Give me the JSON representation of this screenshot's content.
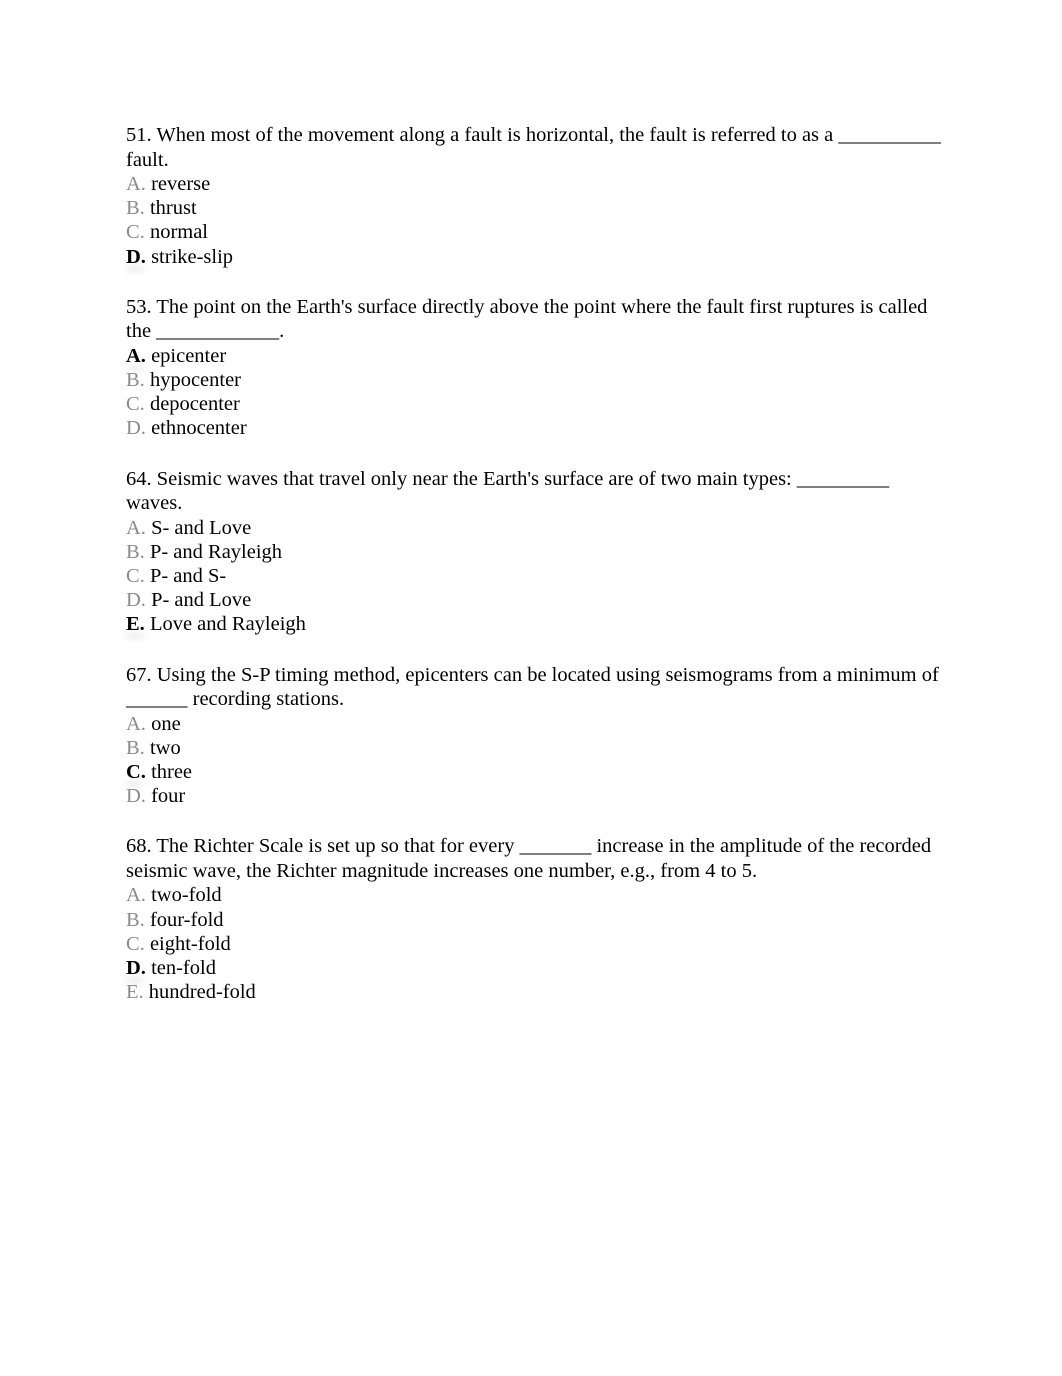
{
  "questions": [
    {
      "number": "51.",
      "text": "When most of the movement along a fault is horizontal, the fault is referred to as a __________ fault.",
      "options": [
        {
          "letter": "A.",
          "text": "reverse",
          "correct": false
        },
        {
          "letter": "B.",
          "text": "thrust",
          "correct": false
        },
        {
          "letter": "C.",
          "text": "normal",
          "correct": false
        },
        {
          "letter": "D.",
          "text": "strike-slip",
          "correct": true
        }
      ]
    },
    {
      "number": "53.",
      "text": "The point on the Earth's surface directly above the point where the fault first ruptures is called the ____________.",
      "options": [
        {
          "letter": "A.",
          "text": "epicenter",
          "correct": true
        },
        {
          "letter": "B.",
          "text": "hypocenter",
          "correct": false
        },
        {
          "letter": "C.",
          "text": "depocenter",
          "correct": false
        },
        {
          "letter": "D.",
          "text": "ethnocenter",
          "correct": false
        }
      ]
    },
    {
      "number": "64.",
      "text": "Seismic waves that travel only near the Earth's surface are of two main types: _________ waves.",
      "options": [
        {
          "letter": "A.",
          "text": "S- and Love",
          "correct": false
        },
        {
          "letter": "B.",
          "text": "P- and Rayleigh",
          "correct": false
        },
        {
          "letter": "C.",
          "text": "P- and S-",
          "correct": false
        },
        {
          "letter": "D.",
          "text": "P- and Love",
          "correct": false
        },
        {
          "letter": "E.",
          "text": "Love and Rayleigh",
          "correct": true
        }
      ]
    },
    {
      "number": "67.",
      "text": "Using the S-P timing method, epicenters can be located using seismograms from a minimum of ______ recording stations.",
      "options": [
        {
          "letter": "A.",
          "text": "one",
          "correct": false
        },
        {
          "letter": "B.",
          "text": "two",
          "correct": false
        },
        {
          "letter": "C.",
          "text": "three",
          "correct": true
        },
        {
          "letter": "D.",
          "text": "four",
          "correct": false
        }
      ]
    },
    {
      "number": "68.",
      "text": "The Richter Scale is set up so that for every _______ increase in the amplitude of the recorded seismic wave, the Richter magnitude increases one number, e.g., from 4 to 5.",
      "options": [
        {
          "letter": "A.",
          "text": "two-fold",
          "correct": false
        },
        {
          "letter": "B.",
          "text": "four-fold",
          "correct": false
        },
        {
          "letter": "C.",
          "text": "eight-fold",
          "correct": false
        },
        {
          "letter": "D.",
          "text": "ten-fold",
          "correct": true
        },
        {
          "letter": "E.",
          "text": "hundred-fold",
          "correct": false
        }
      ]
    }
  ]
}
